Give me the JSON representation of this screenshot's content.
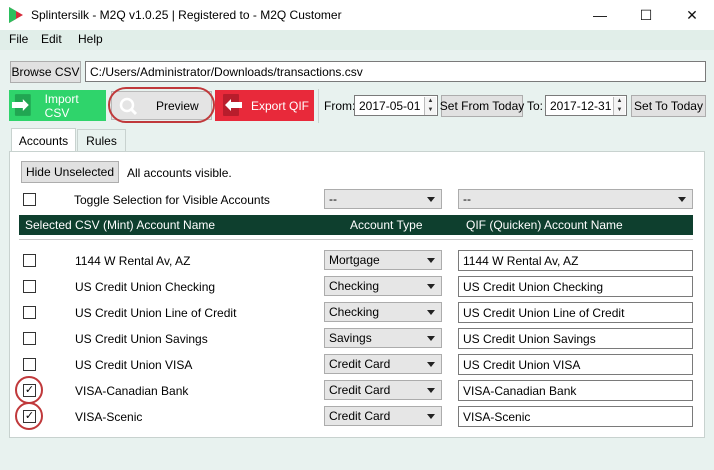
{
  "window": {
    "title": "Splintersilk - M2Q v1.0.25 | Registered to - M2Q Customer",
    "minimize_glyph": "—",
    "maximize_glyph": "☐",
    "close_glyph": "✕"
  },
  "menu": [
    "File",
    "Edit",
    "Help"
  ],
  "file_row": {
    "browse_label": "Browse CSV",
    "path_value": "C:/Users/Administrator/Downloads/transactions.csv"
  },
  "toolbar": {
    "import_label": "Import CSV",
    "preview_label": "Preview",
    "export_label": "Export QIF",
    "from_label": "From:",
    "from_date": "2017-05-01",
    "set_from_today_label": "Set From Today",
    "to_label": "To:",
    "to_date": "2017-12-31",
    "set_to_today_label": "Set To Today"
  },
  "tabs": [
    "Accounts",
    "Rules"
  ],
  "accounts_tab": {
    "hide_unselected_label": "Hide Unselected",
    "visibility_status": "All accounts visible.",
    "toggle_label": "Toggle Selection for Visible Accounts",
    "bulk_type_value": "--",
    "bulk_qif_value": "--",
    "columns": [
      "Selected",
      "CSV (Mint) Account Name",
      "Account Type",
      "QIF (Quicken) Account Name"
    ],
    "rows": [
      {
        "selected": false,
        "csv_name": "1144 W Rental Av, AZ",
        "type": "Mortgage",
        "qif_name": "1144 W Rental Av, AZ"
      },
      {
        "selected": false,
        "csv_name": "US Credit Union Checking",
        "type": "Checking",
        "qif_name": "US Credit Union Checking"
      },
      {
        "selected": false,
        "csv_name": "US Credit Union Line of Credit",
        "type": "Checking",
        "qif_name": "US Credit Union Line of Credit"
      },
      {
        "selected": false,
        "csv_name": "US Credit Union Savings",
        "type": "Savings",
        "qif_name": "US Credit Union Savings"
      },
      {
        "selected": false,
        "csv_name": "US Credit Union VISA",
        "type": "Credit Card",
        "qif_name": "US Credit Union VISA"
      },
      {
        "selected": true,
        "csv_name": "VISA-Canadian Bank",
        "type": "Credit Card",
        "qif_name": "VISA-Canadian Bank"
      },
      {
        "selected": true,
        "csv_name": "VISA-Scenic",
        "type": "Credit Card",
        "qif_name": "VISA-Scenic"
      }
    ]
  },
  "colors": {
    "import_green": "#2fd46b",
    "export_red": "#e8293a",
    "header_dark_green": "#0e3f2e",
    "highlight_ring": "#c0393b"
  }
}
